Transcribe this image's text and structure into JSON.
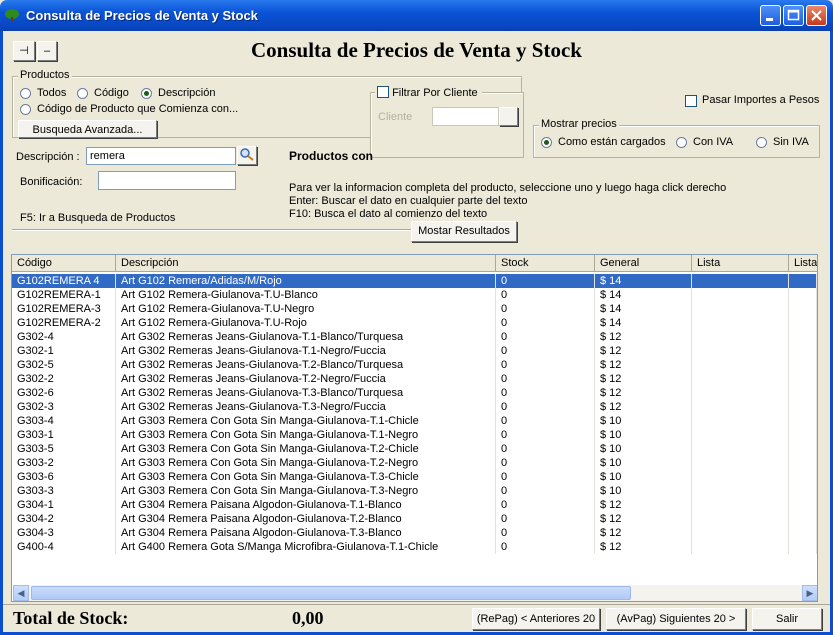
{
  "window": {
    "title": "Consulta de Precios de Venta y Stock"
  },
  "toolbar": {
    "pin_label": "⊣",
    "minus_label": "–"
  },
  "header": {
    "title": "Consulta de Precios de Venta y Stock"
  },
  "productos": {
    "group_label": "Productos",
    "options": [
      "Todos",
      "Código",
      "Descripción",
      "Código de Producto que Comienza con..."
    ],
    "selected": "Descripción",
    "advanced_button": "Busqueda Avanzada..."
  },
  "filtro_cliente": {
    "checkbox_label": "Filtrar Por Cliente",
    "checked": false,
    "cliente_label": "Cliente",
    "cliente_value": ""
  },
  "pasar_importes": {
    "label": "Pasar Importes a Pesos",
    "checked": false
  },
  "mostrar_precios": {
    "group_label": "Mostrar precios",
    "options": [
      "Como están cargados",
      "Con IVA",
      "Sin IVA"
    ],
    "selected": "Como están cargados"
  },
  "descripcion": {
    "label": "Descripción :",
    "value": "remera"
  },
  "bonificacion": {
    "label": "Bonificación:",
    "value": ""
  },
  "productos_con": {
    "label": "Productos con"
  },
  "hints": {
    "line1": "Para ver la informacion completa del producto, seleccione uno y luego haga click derecho",
    "line2": "Enter: Buscar el dato en cualquier parte del texto",
    "line3": "F10: Busca el dato al comienzo del texto"
  },
  "f5_hint": "F5: Ir a Busqueda de Productos",
  "mostrar_resultados": "Mostar Resultados",
  "table": {
    "columns": [
      "Código",
      "Descripción",
      "Stock",
      "General",
      "Lista",
      "Lista"
    ],
    "selected_index": 0,
    "rows": [
      [
        "G102REMERA 4",
        "Art G102 Remera/Adidas/M/Rojo",
        "0",
        "$ 14",
        "",
        ""
      ],
      [
        "G102REMERA-1",
        "Art G102 Remera-Giulanova-T.U-Blanco",
        "0",
        "$ 14",
        "",
        ""
      ],
      [
        "G102REMERA-3",
        "Art G102 Remera-Giulanova-T.U-Negro",
        "0",
        "$ 14",
        "",
        ""
      ],
      [
        "G102REMERA-2",
        "Art G102 Remera-Giulanova-T.U-Rojo",
        "0",
        "$ 14",
        "",
        ""
      ],
      [
        "G302-4",
        "Art G302 Remeras Jeans-Giulanova-T.1-Blanco/Turquesa",
        "0",
        "$ 12",
        "",
        ""
      ],
      [
        "G302-1",
        "Art G302 Remeras Jeans-Giulanova-T.1-Negro/Fuccia",
        "0",
        "$ 12",
        "",
        ""
      ],
      [
        "G302-5",
        "Art G302 Remeras Jeans-Giulanova-T.2-Blanco/Turquesa",
        "0",
        "$ 12",
        "",
        ""
      ],
      [
        "G302-2",
        "Art G302 Remeras Jeans-Giulanova-T.2-Negro/Fuccia",
        "0",
        "$ 12",
        "",
        ""
      ],
      [
        "G302-6",
        "Art G302 Remeras Jeans-Giulanova-T.3-Blanco/Turquesa",
        "0",
        "$ 12",
        "",
        ""
      ],
      [
        "G302-3",
        "Art G302 Remeras Jeans-Giulanova-T.3-Negro/Fuccia",
        "0",
        "$ 12",
        "",
        ""
      ],
      [
        "G303-4",
        "Art G303 Remera Con Gota Sin Manga-Giulanova-T.1-Chicle",
        "0",
        "$ 10",
        "",
        ""
      ],
      [
        "G303-1",
        "Art G303 Remera Con Gota Sin Manga-Giulanova-T.1-Negro",
        "0",
        "$ 10",
        "",
        ""
      ],
      [
        "G303-5",
        "Art G303 Remera Con Gota Sin Manga-Giulanova-T.2-Chicle",
        "0",
        "$ 10",
        "",
        ""
      ],
      [
        "G303-2",
        "Art G303 Remera Con Gota Sin Manga-Giulanova-T.2-Negro",
        "0",
        "$ 10",
        "",
        ""
      ],
      [
        "G303-6",
        "Art G303 Remera Con Gota Sin Manga-Giulanova-T.3-Chicle",
        "0",
        "$ 10",
        "",
        ""
      ],
      [
        "G303-3",
        "Art G303 Remera Con Gota Sin Manga-Giulanova-T.3-Negro",
        "0",
        "$ 10",
        "",
        ""
      ],
      [
        "G304-1",
        "Art G304 Remera Paisana Algodon-Giulanova-T.1-Blanco",
        "0",
        "$ 12",
        "",
        ""
      ],
      [
        "G304-2",
        "Art G304 Remera Paisana Algodon-Giulanova-T.2-Blanco",
        "0",
        "$ 12",
        "",
        ""
      ],
      [
        "G304-3",
        "Art G304 Remera Paisana Algodon-Giulanova-T.3-Blanco",
        "0",
        "$ 12",
        "",
        ""
      ],
      [
        "G400-4",
        "Art G400 Remera Gota S/Manga Microfibra-Giulanova-T.1-Chicle",
        "0",
        "$ 12",
        "",
        ""
      ]
    ]
  },
  "footer": {
    "total_label": "Total de Stock:",
    "total_value": "0,00",
    "prev_button": "(RePag) < Anteriores 20",
    "next_button": "(AvPag) Siguientes 20 >",
    "exit_button": "Salir"
  },
  "colors": {
    "titlebar": "#0a53d6",
    "selection": "#316ac5",
    "face": "#ece9d8"
  }
}
